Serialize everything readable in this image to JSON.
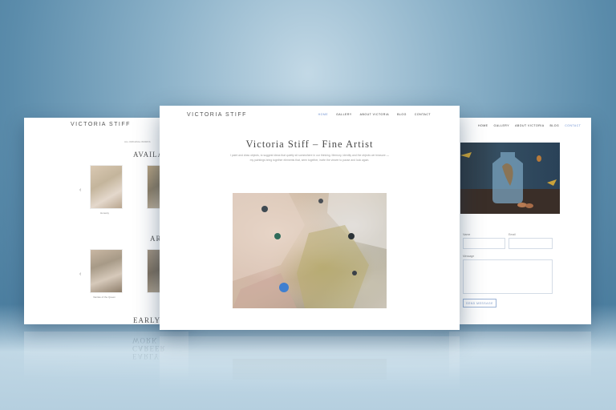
{
  "brand": "VICTORIA STIFF",
  "center_page": {
    "nav": [
      "HOME",
      "GALLERY",
      "ABOUT VICTORIA",
      "BLOG",
      "CONTACT"
    ],
    "active_nav": "HOME",
    "title": "Victoria Stiff – Fine Artist",
    "intro": "I paint and draw objects, to suggest ideas that quietly sit somewhere in our thinking. Memory, identity and the objects we treasure — my paintings bring together elements that, seen together, invite the viewer to pause and look again."
  },
  "left_page": {
    "subtitle": "ALL ORIGINAL WORKS",
    "available_heading": "AVAILA",
    "archive_heading": "AR",
    "early_heading": "EARLY CA",
    "caption_1": "Honesty",
    "caption_2": "Vanitas of the Queen",
    "prev_arrow": "‹"
  },
  "right_page": {
    "nav": [
      "HOME",
      "GALLERY",
      "ABOUT VICTORIA",
      "BLOG",
      "CONTACT"
    ],
    "active_nav": "CONTACT",
    "name_label": "Name",
    "email_label": "Email",
    "message_label": "Message",
    "submit_label": "SEND MESSAGE"
  },
  "reflection": {
    "left_text": "EARLY CAREER WORK"
  },
  "colors": {
    "background_top": "#c3d9e6",
    "background_bottom": "#3f7396",
    "nav_active": "#6b8fd0",
    "button_border": "#9db4d6"
  }
}
